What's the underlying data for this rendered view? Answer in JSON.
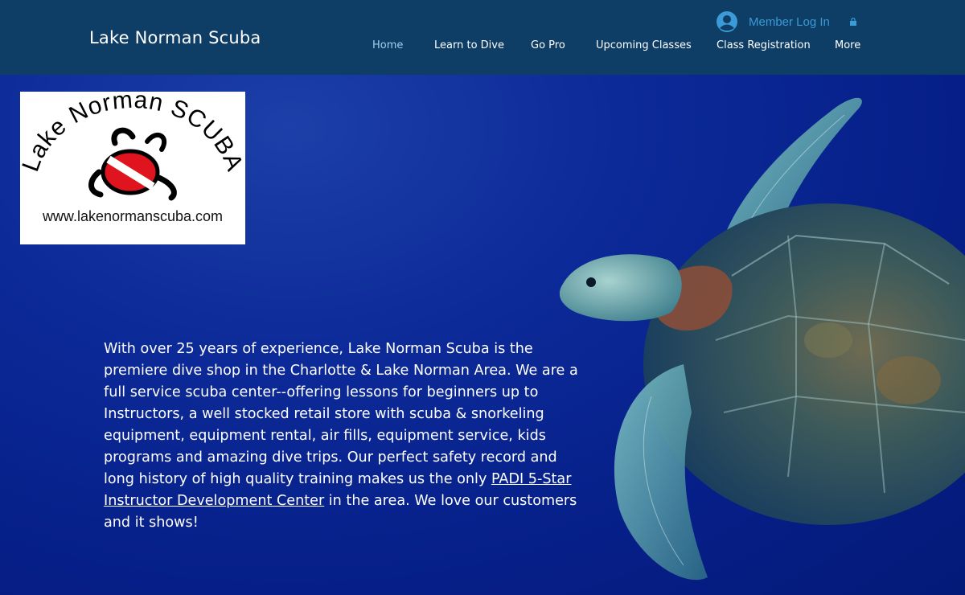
{
  "header": {
    "brand": "Lake Norman Scuba",
    "member_login": "Member Log In",
    "avatar_icon": "user-avatar-icon",
    "lock_icon": "lock-icon",
    "nav": [
      {
        "label": "Home",
        "active": true
      },
      {
        "label": "Learn to Dive"
      },
      {
        "label": "Go Pro"
      },
      {
        "label": "Upcoming Classes"
      },
      {
        "label": "Class Registration"
      },
      {
        "label": "More"
      }
    ]
  },
  "logo": {
    "arc_text": "Lake Norman SCUBA",
    "url": "www.lakenormanscuba.com"
  },
  "intro": {
    "before_link": "With over 25 years of experience, Lake Norman Scuba is the premiere dive shop in the Charlotte & Lake Norman Area.  We are a full service scuba center--offering lessons for beginners up to Instructors, a well stocked retail store with scuba & snorkeling equipment, equipment rental, air fills, equipment service, kids programs and amazing dive trips.  Our perfect safety record and long history of high quality training makes us the only ",
    "link": "PADI 5-Star Instructor Development Center",
    "after_link": " in the area.  We love our customers and it shows!"
  },
  "colors": {
    "header_bg": "#0e3d66",
    "hero_bg": "#0c2a98",
    "accent": "#3a9bd6"
  }
}
